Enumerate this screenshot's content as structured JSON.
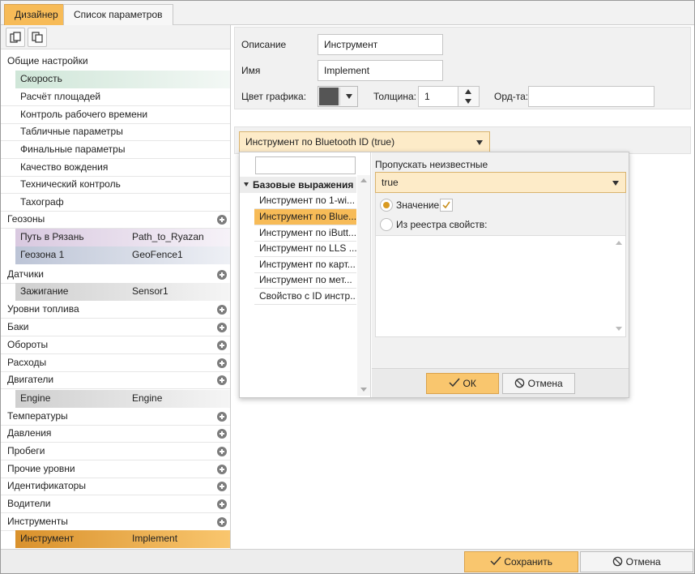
{
  "tabs": [
    "Дизайнер",
    "Список параметров"
  ],
  "left": {
    "general": "Общие настройки",
    "items": [
      "Скорость",
      "Расчёт площадей",
      "Контроль рабочего времени",
      "Табличные параметры",
      "Финальные параметры",
      "Качество вождения",
      "Технический контроль",
      "Тахограф"
    ],
    "geozones": {
      "label": "Геозоны",
      "chips": [
        {
          "name": "Путь в Рязань",
          "value": "Path_to_Ryazan"
        },
        {
          "name": "Геозона 1",
          "value": "GeoFence1"
        }
      ]
    },
    "sensors": {
      "label": "Датчики",
      "chips": [
        {
          "name": "Зажигание",
          "value": "Sensor1"
        }
      ]
    },
    "groups1": [
      "Уровни топлива",
      "Баки",
      "Обороты",
      "Расходы"
    ],
    "engines": {
      "label": "Двигатели",
      "chips": [
        {
          "name": "Engine",
          "value": "Engine"
        }
      ]
    },
    "groups2": [
      "Температуры",
      "Давления",
      "Пробеги",
      "Прочие уровни",
      "Идентификаторы",
      "Водители"
    ],
    "instruments": {
      "label": "Инструменты",
      "chips": [
        {
          "name": "Инструмент",
          "value": "Implement"
        }
      ]
    }
  },
  "form": {
    "desc_label": "Описание",
    "desc_value": "Инструмент",
    "name_label": "Имя",
    "name_value": "Implement",
    "color_label": "Цвет графика:",
    "thick_label": "Толщина:",
    "thick_value": "1",
    "ord_label": "Орд-та:",
    "ord_value": ""
  },
  "selector": "Инструмент по Bluetooth ID (true)",
  "popup": {
    "search": "",
    "group": "Базовые выражения",
    "items": [
      "Инструмент по 1-wi...",
      "Инструмент по Blue...",
      "Инструмент по iButt...",
      "Инструмент по LLS ...",
      "Инструмент по карт...",
      "Инструмент по мет...",
      "Свойство с ID инстр..."
    ],
    "skip_label": "Пропускать неизвестные",
    "skip_value": "true",
    "value_label": "Значение:",
    "registry_label": "Из реестра свойств:",
    "ok": "ОК",
    "cancel": "Отмена"
  },
  "footer": {
    "save": "Сохранить",
    "cancel": "Отмена"
  },
  "colors": {
    "accent": "#f7bb57",
    "chip_speed": "#dfeee6",
    "chip_geo1": "#e4dbea",
    "chip_geo2": "#cdd3e0",
    "chip_gray": "#dcdcdc",
    "swatch": "#555555"
  }
}
